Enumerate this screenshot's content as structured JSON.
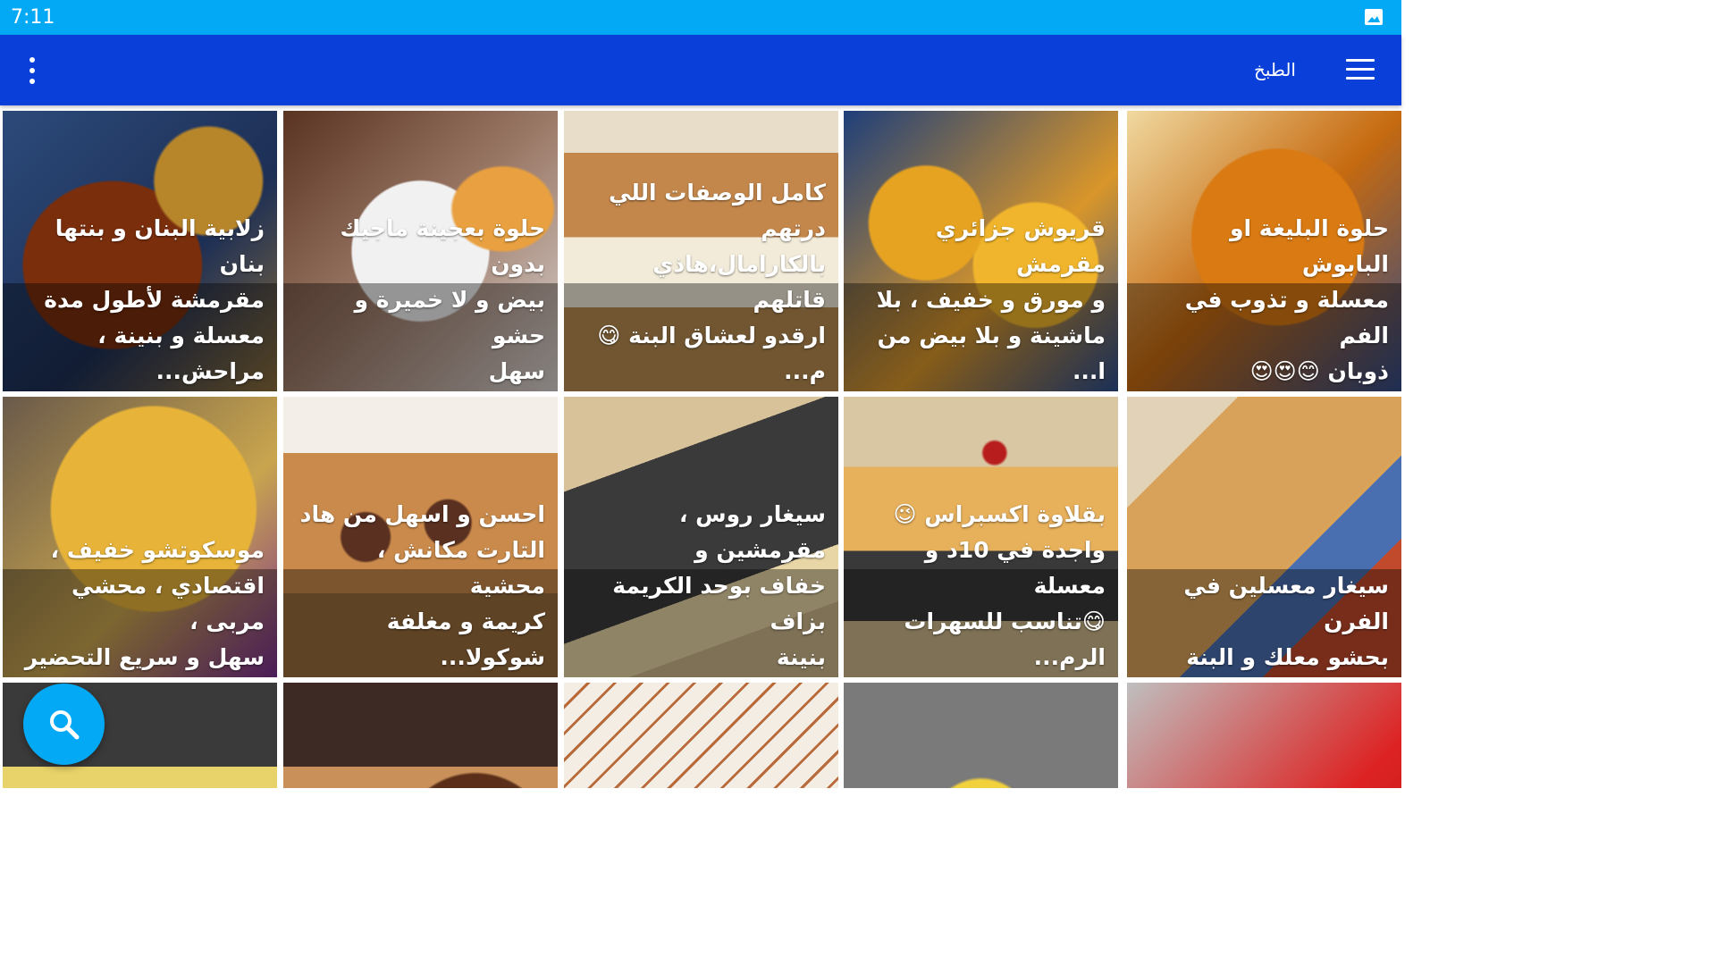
{
  "status_bar": {
    "time": "7:11",
    "icon": "image-notification-icon"
  },
  "app_bar": {
    "title": "الطبخ",
    "menu_icon": "hamburger-menu-icon",
    "overflow_icon": "more-vert-icon"
  },
  "fab": {
    "icon": "search-icon"
  },
  "colors": {
    "status_bar": "#03a9f4",
    "app_bar": "#0a3fd9",
    "fab": "#03a9f4"
  },
  "recipes": [
    {
      "title": "زلابية البنان و بنتها بنان\nمقرمشة لأطول مدة\nمعسلة و بنينة ، مراحش..."
    },
    {
      "title": "حلوة بعجينة ماجيك بدون\nبيض و لا خميرة و حشو\nسهل"
    },
    {
      "title": "كامل الوصفات اللي درتهم\nبالكارامال،هاذي قاتلهم\nارقدو لعشاق البنة 😋 م..."
    },
    {
      "title": "قريوش جزائري مقرمش\nو مورق و خفيف ، بلا\nماشينة و بلا بيض من ا..."
    },
    {
      "title": "حلوة البليغة او البابوش\nمعسلة و تذوب في الفم\nذوبان 😊😍😍"
    },
    {
      "title": "موسكوتشو خفيف ،\nاقتصادي ، محشي مربى ،\nسهل و سريع التحضير"
    },
    {
      "title": "احسن و اسهل من هاد\nالتارت مكانش ، محشية\nكريمة و مغلفة شوكولا..."
    },
    {
      "title": "سيغار روس ، مقرمشين و\nخفاف بوحد الكريمة بزاف\nبنينة"
    },
    {
      "title": "بقلاوة اكسبراس 😉\nواجدة في 10د و معسلة\n😋تناسب للسهرات الرم..."
    },
    {
      "title": "سيغار معسلين في الفرن\nبحشو معلك و البنة"
    },
    {
      "title": ""
    },
    {
      "title": ""
    },
    {
      "title": ""
    },
    {
      "title": ""
    },
    {
      "title": ""
    }
  ]
}
